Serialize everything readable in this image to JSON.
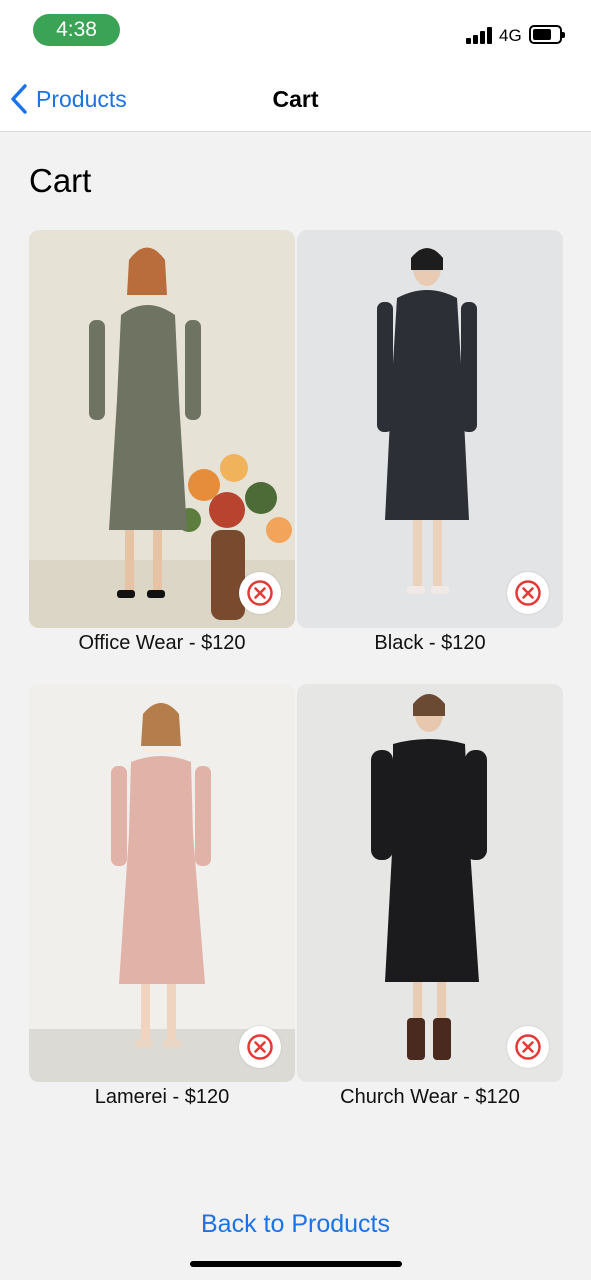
{
  "status": {
    "time": "4:38",
    "network": "4G",
    "battery_level": 0.7,
    "colors": {
      "time_pill": "#3aa356"
    }
  },
  "nav": {
    "back_label": "Products",
    "title": "Cart"
  },
  "page": {
    "heading": "Cart"
  },
  "cart_items": [
    {
      "caption": "Office Wear - $120",
      "name": "Office Wear",
      "price": "$120",
      "remove_icon": "close-circle-icon"
    },
    {
      "caption": "Black - $120",
      "name": "Black",
      "price": "$120",
      "remove_icon": "close-circle-icon"
    },
    {
      "caption": "Lamerei - $120",
      "name": "Lamerei",
      "price": "$120",
      "remove_icon": "close-circle-icon"
    },
    {
      "caption": "Church Wear - $120",
      "name": "Church Wear",
      "price": "$120",
      "remove_icon": "close-circle-icon"
    }
  ],
  "footer": {
    "back_link": "Back to Products"
  },
  "colors": {
    "accent": "#1a73e8",
    "remove_icon": "#e53935"
  }
}
